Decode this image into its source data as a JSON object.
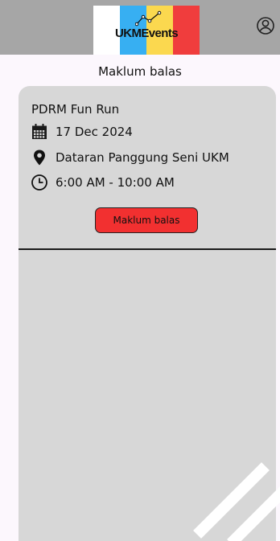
{
  "header": {
    "logo_text": "UKMEvents",
    "logo_colors": [
      "#ffffff",
      "#37aff2",
      "#fbd84f",
      "#f03d3d"
    ],
    "background": "#a6a6a6",
    "profile_icon": "user-circle-icon"
  },
  "page": {
    "title": "Maklum balas"
  },
  "event": {
    "title": "PDRM Fun Run",
    "date": "17 Dec 2024",
    "date_icon": "calendar-icon",
    "location": "Dataran Panggung Seni UKM",
    "location_icon": "map-pin-icon",
    "time": "6:00 AM - 10:00 AM",
    "time_icon": "clock-icon",
    "button_label": "Maklum balas",
    "button_color": "#f23030"
  }
}
